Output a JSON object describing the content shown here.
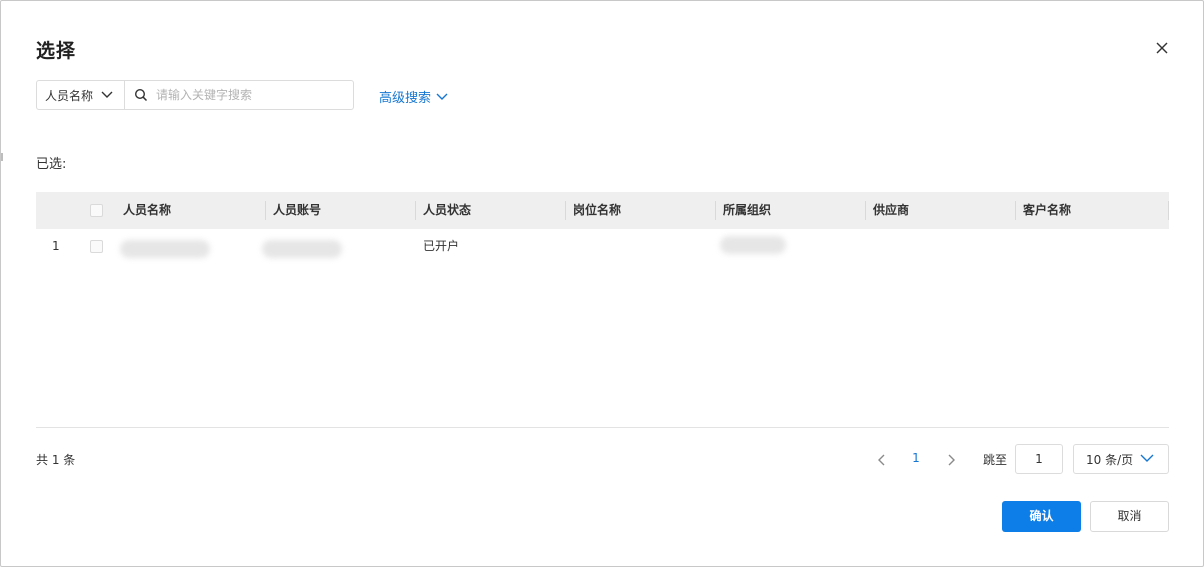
{
  "dialog": {
    "title": "选择",
    "close_icon": "close-icon"
  },
  "search": {
    "field_selected": "人员名称",
    "placeholder": "请输入关键字搜索",
    "advanced_label": "高级搜索"
  },
  "selected": {
    "label": "已选:"
  },
  "table": {
    "columns": [
      "人员名称",
      "人员账号",
      "人员状态",
      "岗位名称",
      "所属组织",
      "供应商",
      "客户名称"
    ],
    "rows": [
      {
        "index": "1",
        "name": "",
        "account": "",
        "status": "已开户",
        "position": "",
        "organization": "",
        "supplier": "",
        "customer": ""
      }
    ]
  },
  "pagination": {
    "total": "共 1 条",
    "current_page": "1",
    "jump_label": "跳至",
    "jump_value": "1",
    "page_size": "10 条/页"
  },
  "footer": {
    "confirm_label": "确认",
    "cancel_label": "取消"
  },
  "colors": {
    "accent": "#0d7ee8",
    "link": "#1677d2",
    "header_bg": "#efefef"
  }
}
